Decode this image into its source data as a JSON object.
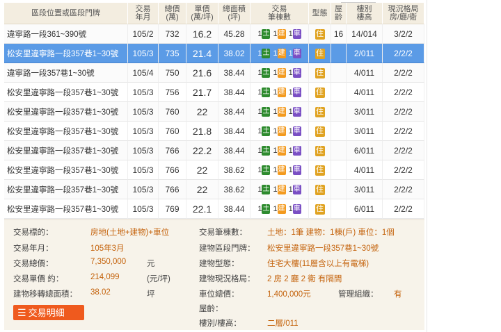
{
  "headers": {
    "addr": "區段位置或區段門牌",
    "ym": "交易\n年月",
    "total": "總價\n(萬)",
    "unit": "單價\n(萬/坪)",
    "area": "總面積\n(坪)",
    "counts": "交易\n筆棟數",
    "type": "型態",
    "age": "屋\n齡",
    "floor": "樓別\n樓高",
    "layout": "現況格局\n房/廳/衛"
  },
  "badges": {
    "land": "土",
    "building": "建",
    "parking": "車",
    "type": "住"
  },
  "rows": [
    {
      "addr": "違寧路一段361~390號",
      "ym": "105/2",
      "total": "732",
      "unit": "16.2",
      "area": "45.28",
      "land": "1",
      "bld": "1",
      "park": "1",
      "age": "16",
      "floor": "14/014",
      "layout": "3/2/2",
      "sel": false
    },
    {
      "addr": "松安里違寧路一段357巷1~30號",
      "ym": "105/3",
      "total": "735",
      "unit": "21.4",
      "area": "38.02",
      "land": "1",
      "bld": "1",
      "park": "1",
      "age": "",
      "floor": "2/011",
      "layout": "2/2/2",
      "sel": true
    },
    {
      "addr": "違寧路一段357巷1~30號",
      "ym": "105/4",
      "total": "750",
      "unit": "21.6",
      "area": "38.44",
      "land": "1",
      "bld": "1",
      "park": "1",
      "age": "",
      "floor": "4/011",
      "layout": "2/2/2",
      "sel": false
    },
    {
      "addr": "松安里違寧路一段357巷1~30號",
      "ym": "105/3",
      "total": "756",
      "unit": "21.7",
      "area": "38.44",
      "land": "1",
      "bld": "1",
      "park": "1",
      "age": "",
      "floor": "4/011",
      "layout": "2/2/2",
      "sel": false
    },
    {
      "addr": "松安里違寧路一段357巷1~30號",
      "ym": "105/3",
      "total": "760",
      "unit": "22",
      "area": "38.44",
      "land": "1",
      "bld": "1",
      "park": "1",
      "age": "",
      "floor": "3/011",
      "layout": "2/2/2",
      "sel": false
    },
    {
      "addr": "松安里違寧路一段357巷1~30號",
      "ym": "105/3",
      "total": "760",
      "unit": "21.8",
      "area": "38.44",
      "land": "1",
      "bld": "1",
      "park": "1",
      "age": "",
      "floor": "3/011",
      "layout": "2/2/2",
      "sel": false
    },
    {
      "addr": "松安里違寧路一段357巷1~30號",
      "ym": "105/3",
      "total": "766",
      "unit": "22.2",
      "area": "38.44",
      "land": "1",
      "bld": "1",
      "park": "1",
      "age": "",
      "floor": "6/011",
      "layout": "2/2/2",
      "sel": false
    },
    {
      "addr": "松安里違寧路一段357巷1~30號",
      "ym": "105/3",
      "total": "766",
      "unit": "22",
      "area": "38.62",
      "land": "1",
      "bld": "1",
      "park": "1",
      "age": "",
      "floor": "4/011",
      "layout": "2/2/2",
      "sel": false
    },
    {
      "addr": "松安里違寧路一段357巷1~30號",
      "ym": "105/3",
      "total": "766",
      "unit": "22",
      "area": "38.62",
      "land": "1",
      "bld": "1",
      "park": "1",
      "age": "",
      "floor": "3/011",
      "layout": "2/2/2",
      "sel": false
    },
    {
      "addr": "松安里違寧路一段357巷1~30號",
      "ym": "105/3",
      "total": "769",
      "unit": "22.1",
      "area": "38.44",
      "land": "1",
      "bld": "1",
      "park": "1",
      "age": "",
      "floor": "6/011",
      "layout": "2/2/2",
      "sel": false
    }
  ],
  "detail": {
    "target_label": "交易標的：",
    "target_value": "房地(土地+建物)+車位",
    "ym_label": "交易年月：",
    "ym_value": "105年3月",
    "total_label": "交易總價：",
    "total_value": "7,350,000",
    "total_unit": "元",
    "unit_label": "交易單價 約：",
    "unit_value": "214,099",
    "unit_unit": "(元/坪)",
    "area_label": "建物移轉總面積：",
    "area_value": "38.02",
    "area_unit": "坪",
    "count_label": "交易筆棟數：",
    "count_value": "土地：1筆 建物：1棟(戶) 車位：1個",
    "addr_label": "建物區段門牌：",
    "addr_value": "松安里違寧路一段357巷1~30號",
    "btype_label": "建物型態：",
    "btype_value": "住宅大樓(11層含以上有電梯)",
    "layout_label": "建物現況格局：",
    "layout_value": "2 房 2 廳 2 衛 有隔間",
    "park_label": "車位總價：",
    "park_value": "1,400,000元",
    "mgmt_label": "管理組織：",
    "mgmt_value": "有",
    "age_label": "屋齡：",
    "floor_label": "樓別/樓高：",
    "floor_value": "二層/011",
    "button_label": "交易明細"
  }
}
